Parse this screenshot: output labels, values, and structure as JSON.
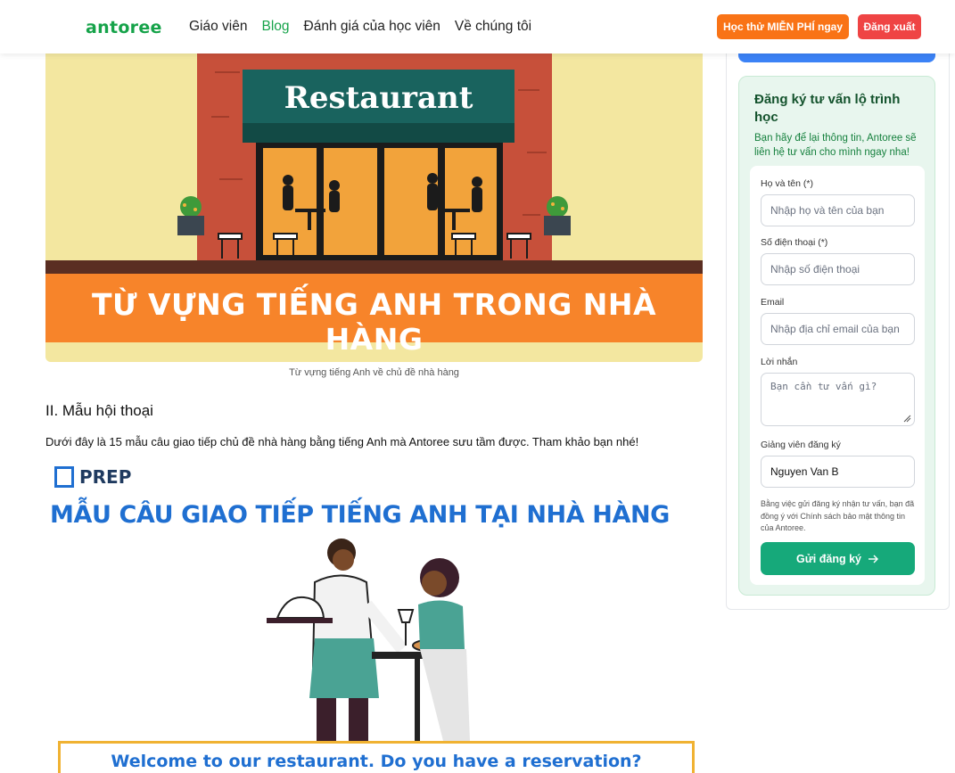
{
  "header": {
    "logo": "antoree",
    "nav": [
      {
        "label": "Giáo viên"
      },
      {
        "label": "Blog"
      },
      {
        "label": "Đánh giá của học viên"
      },
      {
        "label": "Về chúng tôi"
      }
    ],
    "trial_button": "Học thử MIỄN PHÍ ngay",
    "logout_button": "Đăng xuất"
  },
  "article": {
    "image1": {
      "sign_text": "Restaurant",
      "banner_text": "TỪ VỰNG TIẾNG ANH TRONG NHÀ HÀNG"
    },
    "caption": "Từ vựng tiếng Anh về chủ đề nhà hàng",
    "section_heading": "II. Mẫu hội thoại",
    "intro": "Dưới đây là 15 mẫu câu giao tiếp chủ đề nhà hàng bằng tiếng Anh mà Antoree sưu tầm được. Tham khảo bạn nhé!",
    "image2": {
      "brand": "PREP",
      "title": "MẪU CÂU GIAO TIẾP TIẾNG ANH TẠI NHÀ HÀNG",
      "speech": "Welcome to our restaurant. Do you have a reservation?"
    }
  },
  "sidebar": {
    "title": "Đăng ký tư vấn lộ trình học",
    "subtitle": "Bạn hãy để lại thông tin, Antoree sẽ liên hệ tư vấn cho mình ngay nha!",
    "fields": {
      "name": {
        "label": "Họ và tên (*)",
        "placeholder": "Nhập họ và tên của bạn"
      },
      "phone": {
        "label": "Số điện thoại (*)",
        "placeholder": "Nhập số điện thoại"
      },
      "email": {
        "label": "Email",
        "placeholder": "Nhập địa chỉ email của bạn"
      },
      "message": {
        "label": "Lời nhắn",
        "placeholder": "Bạn cần tư vấn gì?"
      },
      "teacher": {
        "label": "Giảng viên đăng ký",
        "value": "Nguyen Van B"
      }
    },
    "disclaimer": "Bằng việc gửi đăng ký nhận tư vấn, bạn đã đồng ý với Chính sách bảo mật thông tin của Antoree.",
    "submit_label": "Gửi đăng ký",
    "colors": {
      "primary": "#16a34a",
      "accent": "#f97316",
      "danger": "#ef4444",
      "card_bg": "#e8f6ee"
    }
  }
}
